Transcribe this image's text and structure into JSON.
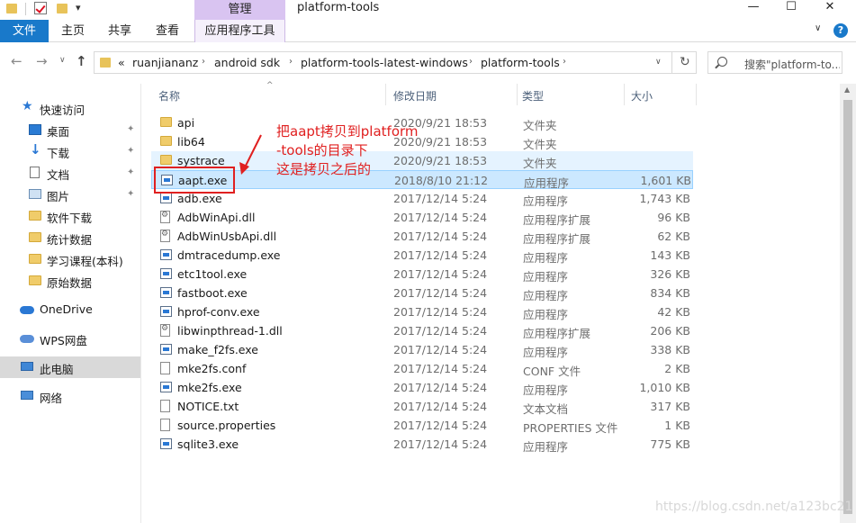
{
  "window": {
    "title": "platform-tools",
    "manage_tab": "管理",
    "min": "—",
    "max": "☐",
    "close": "✕"
  },
  "ribbon": {
    "file": "文件",
    "home": "主页",
    "share": "共享",
    "view": "查看",
    "app_tools": "应用程序工具",
    "expand": "∨",
    "help": "?"
  },
  "nav": {
    "back": "←",
    "forward": "→",
    "dropdown": "∨",
    "up": "↑",
    "overflow": "«",
    "breadcrumb": [
      "ruanjiananz",
      "android sdk",
      "platform-tools-latest-windows",
      "platform-tools"
    ],
    "refresh": "↻",
    "search_placeholder": "搜索\"platform-to..."
  },
  "sidebar": {
    "items": [
      {
        "label": "快速访问",
        "icon": "star-icon"
      },
      {
        "label": "桌面",
        "icon": "desktop-icon",
        "pinned": true
      },
      {
        "label": "下载",
        "icon": "download-icon",
        "pinned": true
      },
      {
        "label": "文档",
        "icon": "document-icon",
        "pinned": true
      },
      {
        "label": "图片",
        "icon": "pictures-icon",
        "pinned": true
      },
      {
        "label": "软件下载",
        "icon": "folder-icon"
      },
      {
        "label": "统计数据",
        "icon": "folder-icon"
      },
      {
        "label": "学习课程(本科)",
        "icon": "folder-icon"
      },
      {
        "label": "原始数据",
        "icon": "folder-icon"
      },
      {
        "label": "OneDrive",
        "icon": "cloud-icon"
      },
      {
        "label": "WPS网盘",
        "icon": "wps-cloud-icon"
      },
      {
        "label": "此电脑",
        "icon": "computer-icon",
        "selected": true
      },
      {
        "label": "网络",
        "icon": "network-icon"
      }
    ],
    "pin_glyph": "📌"
  },
  "columns": {
    "name": "名称",
    "modified": "修改日期",
    "type": "类型",
    "size": "大小",
    "sort_glyph": "^"
  },
  "files": [
    {
      "name": "api",
      "date": "2020/9/21 18:53",
      "type": "文件夹",
      "size": "",
      "kind": "folder"
    },
    {
      "name": "lib64",
      "date": "2020/9/21 18:53",
      "type": "文件夹",
      "size": "",
      "kind": "folder"
    },
    {
      "name": "systrace",
      "date": "2020/9/21 18:53",
      "type": "文件夹",
      "size": "",
      "kind": "folder"
    },
    {
      "name": "aapt.exe",
      "date": "2018/8/10 21:12",
      "type": "应用程序",
      "size": "1,601 KB",
      "kind": "exe"
    },
    {
      "name": "adb.exe",
      "date": "2017/12/14 5:24",
      "type": "应用程序",
      "size": "1,743 KB",
      "kind": "exe"
    },
    {
      "name": "AdbWinApi.dll",
      "date": "2017/12/14 5:24",
      "type": "应用程序扩展",
      "size": "96 KB",
      "kind": "dll"
    },
    {
      "name": "AdbWinUsbApi.dll",
      "date": "2017/12/14 5:24",
      "type": "应用程序扩展",
      "size": "62 KB",
      "kind": "dll"
    },
    {
      "name": "dmtracedump.exe",
      "date": "2017/12/14 5:24",
      "type": "应用程序",
      "size": "143 KB",
      "kind": "exe"
    },
    {
      "name": "etc1tool.exe",
      "date": "2017/12/14 5:24",
      "type": "应用程序",
      "size": "326 KB",
      "kind": "exe"
    },
    {
      "name": "fastboot.exe",
      "date": "2017/12/14 5:24",
      "type": "应用程序",
      "size": "834 KB",
      "kind": "exe"
    },
    {
      "name": "hprof-conv.exe",
      "date": "2017/12/14 5:24",
      "type": "应用程序",
      "size": "42 KB",
      "kind": "exe"
    },
    {
      "name": "libwinpthread-1.dll",
      "date": "2017/12/14 5:24",
      "type": "应用程序扩展",
      "size": "206 KB",
      "kind": "dll"
    },
    {
      "name": "make_f2fs.exe",
      "date": "2017/12/14 5:24",
      "type": "应用程序",
      "size": "338 KB",
      "kind": "exe"
    },
    {
      "name": "mke2fs.conf",
      "date": "2017/12/14 5:24",
      "type": "CONF 文件",
      "size": "2 KB",
      "kind": "txt"
    },
    {
      "name": "mke2fs.exe",
      "date": "2017/12/14 5:24",
      "type": "应用程序",
      "size": "1,010 KB",
      "kind": "exe"
    },
    {
      "name": "NOTICE.txt",
      "date": "2017/12/14 5:24",
      "type": "文本文档",
      "size": "317 KB",
      "kind": "txt"
    },
    {
      "name": "source.properties",
      "date": "2017/12/14 5:24",
      "type": "PROPERTIES 文件",
      "size": "1 KB",
      "kind": "txt"
    },
    {
      "name": "sqlite3.exe",
      "date": "2017/12/14 5:24",
      "type": "应用程序",
      "size": "775 KB",
      "kind": "exe"
    }
  ],
  "annotation": {
    "line1": "把aapt拷贝到platform",
    "line2": "-tools的目录下",
    "line3": "这是拷贝之后的",
    "color": "#e02020"
  },
  "watermark": "https://blog.csdn.net/a123bc21",
  "colors": {
    "accent": "#1979ca",
    "manage_tab": "#d9c4f1",
    "selection": "#cce8ff"
  }
}
